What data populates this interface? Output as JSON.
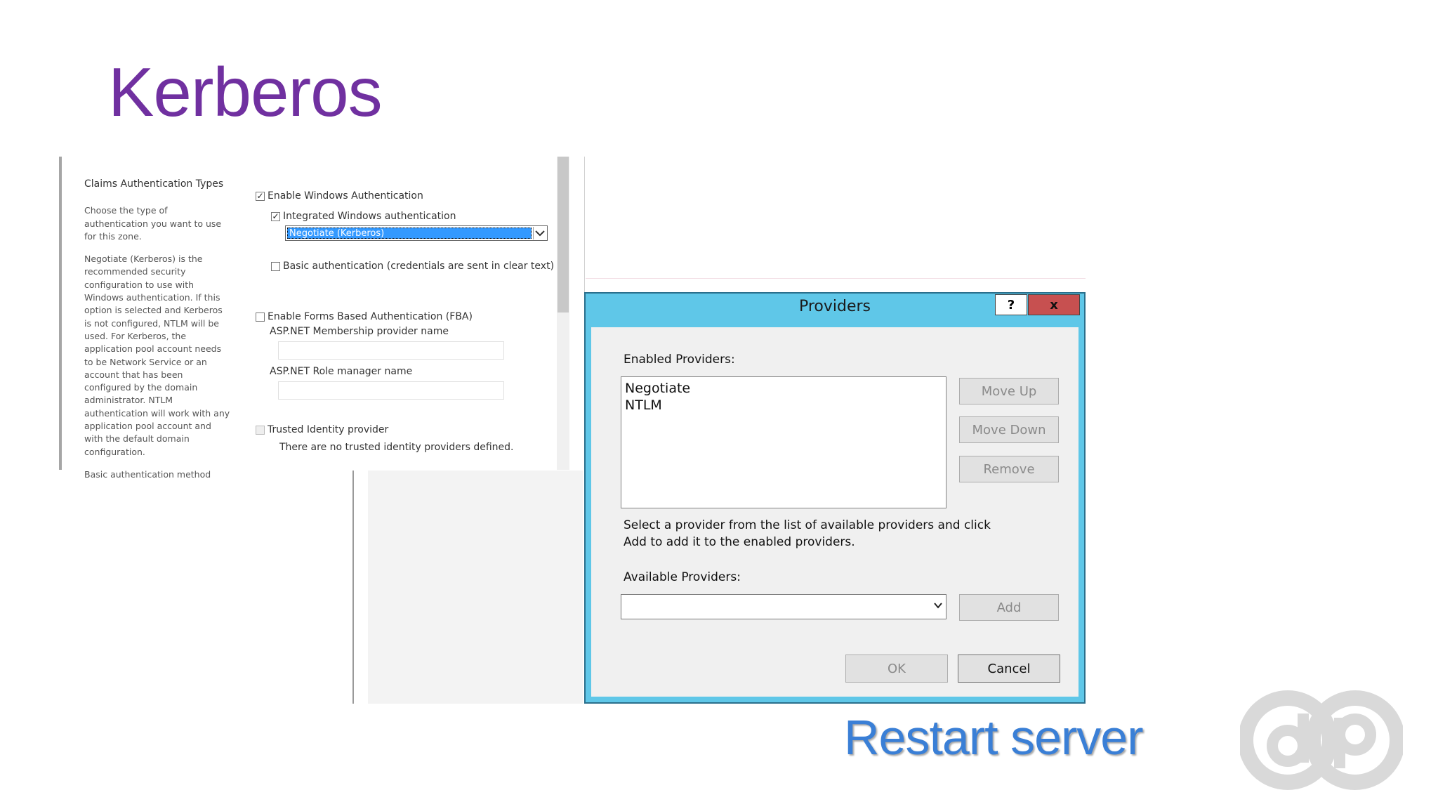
{
  "slide": {
    "title": "Kerberos",
    "footer": "Restart server"
  },
  "settings": {
    "section_title": "Claims Authentication Types",
    "description_1": "Choose the type of authentication you want to use for this zone.",
    "description_2": "Negotiate (Kerberos) is the recommended security configuration to use with Windows authentication. If this option is selected and Kerberos is not configured, NTLM will be used. For Kerberos, the application pool account needs to be Network Service or an account that has been configured by the domain administrator. NTLM authentication will work with any application pool account and with the default domain configuration.",
    "description_3": "Basic authentication method",
    "enable_windows_auth": {
      "label": "Enable Windows Authentication",
      "checked": true
    },
    "integrated_windows_auth": {
      "label": "Integrated Windows authentication",
      "checked": true
    },
    "auth_method_selected": "Negotiate (Kerberos)",
    "basic_auth": {
      "label": "Basic authentication (credentials are sent in clear text)",
      "checked": false
    },
    "enable_fba": {
      "label": "Enable Forms Based Authentication (FBA)",
      "checked": false
    },
    "membership_label": "ASP.NET Membership provider name",
    "role_manager_label": "ASP.NET Role manager name",
    "trusted_identity": {
      "label": "Trusted Identity provider",
      "checked": false
    },
    "trusted_identity_note": "There are no trusted identity providers defined."
  },
  "dialog": {
    "title": "Providers",
    "help_label": "?",
    "close_label": "x",
    "enabled_label": "Enabled Providers:",
    "enabled_providers": [
      "Negotiate",
      "NTLM"
    ],
    "move_up": "Move Up",
    "move_down": "Move Down",
    "remove": "Remove",
    "helper_text": "Select a provider from the list of available providers and click Add to add it to the enabled providers.",
    "available_label": "Available Providers:",
    "available_selected": "",
    "add": "Add",
    "ok": "OK",
    "cancel": "Cancel"
  },
  "colors": {
    "title": "#7030a0",
    "footer": "#3a7fd6",
    "dialog_frame": "#5fc7e8",
    "close_button": "#c75050",
    "selection": "#3399ff"
  }
}
